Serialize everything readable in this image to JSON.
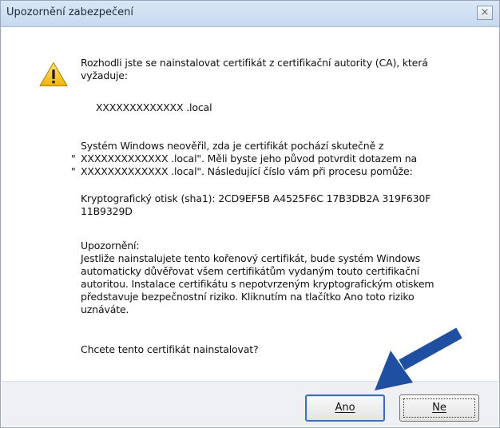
{
  "window": {
    "title": "Upozornění zabezpečení",
    "close_glyph": "×"
  },
  "message": {
    "intro": "Rozhodli jste se nainstalovat certifikát z certifikační autority (CA), která vyžaduje:",
    "host": "XXXXXXXXXXXXX .local",
    "verify_line1": "Systém Windows neověřil, zda je certifikát pochází skutečně z",
    "verify_line2": "XXXXXXXXXXXXX .local\". Měli byste jeho původ potvrdit dotazem na",
    "verify_line3": "XXXXXXXXXXXXX .local\". Následující číslo vám při procesu pomůže:",
    "quote_mark": "\"",
    "thumbprint": "Kryptografický otisk (sha1): 2CD9EF5B A4525F6C 17B3DB2A 319F630F 11B9329D",
    "warning_heading": "Upozornění:",
    "warning_body": "Jestliže nainstalujete tento kořenový certifikát, bude systém Windows automaticky důvěřovat všem certifikátům vydaným touto certifikační autoritou. Instalace certifikátu s nepotvrzeným kryptografickým otiskem představuje bezpečnostní riziko. Kliknutím na tlačítko Ano toto riziko uznáváte.",
    "question": "Chcete tento certifikát nainstalovat?"
  },
  "buttons": {
    "yes_label": "Ano",
    "no_label": "Ne"
  },
  "colors": {
    "arrow": "#1f4fa0",
    "title_bar": "#c7d8ef",
    "warning_yellow": "#f5c518"
  },
  "icons": {
    "warning": "warning-triangle-icon",
    "close": "close-icon",
    "pointer": "pointer-arrow-icon"
  }
}
